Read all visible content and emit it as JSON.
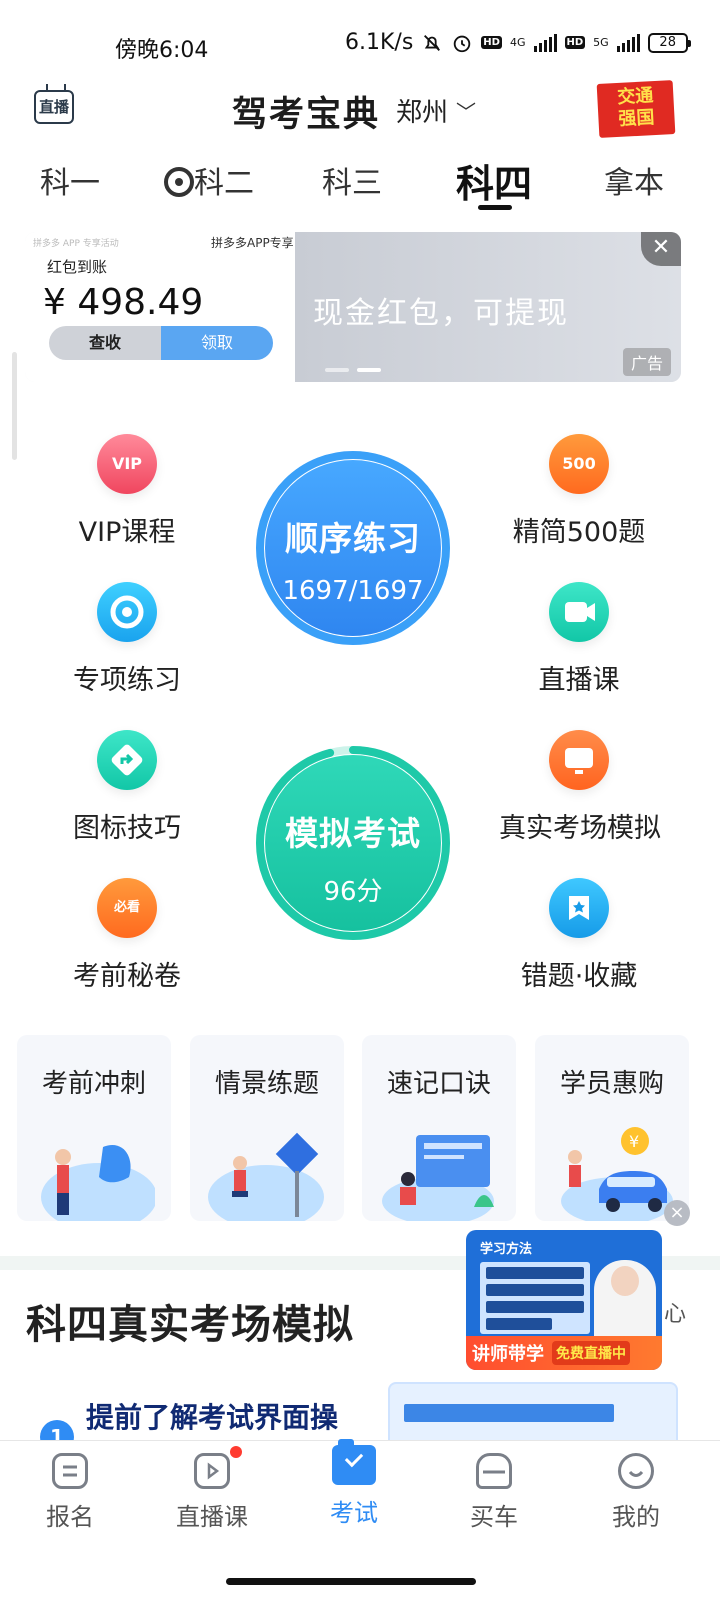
{
  "status_bar": {
    "time": "傍晚6:04",
    "net_speed": "6.1K/s",
    "net1": "4G",
    "net2": "5G",
    "battery": "28"
  },
  "header": {
    "live_label": "直播",
    "title": "驾考宝典",
    "city": "郑州",
    "badge_line1": "交通",
    "badge_line2": "强国"
  },
  "tabs": [
    {
      "label": "科一"
    },
    {
      "label": "科二"
    },
    {
      "label": "科三"
    },
    {
      "label": "科四"
    },
    {
      "label": "拿本"
    }
  ],
  "ad": {
    "small_text": "拼多多 APP 专享活动",
    "source": "拼多多APP专享",
    "heading": "红包到账",
    "amount": "¥ 498.49",
    "btn_check": "查收",
    "btn_claim": "领取",
    "slogan": "现金红包，可提现",
    "tag": "广告"
  },
  "features": {
    "vip": "VIP课程",
    "jing500": "精简500题",
    "zhuanxiang": "专项练习",
    "zhibo": "直播课",
    "tubiao": "图标技巧",
    "zhenshi": "真实考场模拟",
    "miju": "考前秘卷",
    "cuoti": "错题·收藏",
    "glyph_500": "500",
    "glyph_vip": "VIP",
    "glyph_bikan": "必看"
  },
  "practice": {
    "title": "顺序练习",
    "progress": "1697/1697",
    "progress_fraction": 1.0
  },
  "exam": {
    "title": "模拟考试",
    "score": "96分",
    "progress_fraction": 0.96
  },
  "quick_cards": [
    {
      "label": "考前冲刺"
    },
    {
      "label": "情景练题"
    },
    {
      "label": "速记口诀"
    },
    {
      "label": "学员惠购"
    }
  ],
  "float_video": {
    "title": "学习方法",
    "banner_main": "讲师带学",
    "banner_sub": "免费直播中"
  },
  "section": {
    "title": "科四真实考场模拟",
    "step_number": "1",
    "step_text": "提前了解考试界面操"
  },
  "bottom_nav": [
    {
      "label": "报名"
    },
    {
      "label": "直播课"
    },
    {
      "label": "考试"
    },
    {
      "label": "买车"
    },
    {
      "label": "我的"
    }
  ],
  "colors": {
    "accent_blue": "#2f8cf4",
    "exam_green": "#17c3a6"
  }
}
